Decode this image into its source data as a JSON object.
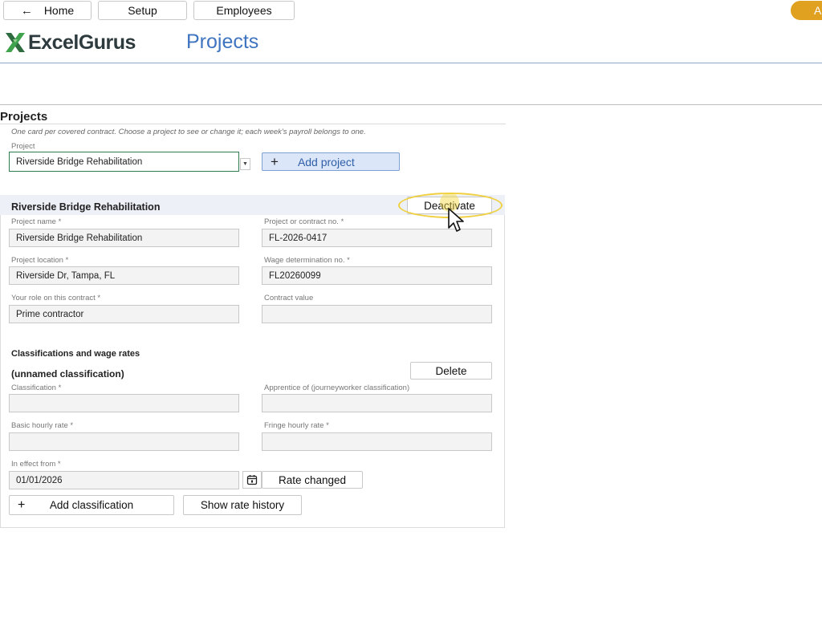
{
  "nav": {
    "home_label": "Home",
    "setup_label": "Setup",
    "employees_label": "Employees",
    "account_initial": "A"
  },
  "header": {
    "logo_text": "ExcelGurus",
    "page_title": "Projects"
  },
  "projects": {
    "section_title": "Projects",
    "description": "One card per covered contract. Choose a project to see or change it; each week's payroll belongs to one.",
    "select_label": "Project",
    "selected_project": "Riverside Bridge Rehabilitation",
    "add_project_label": "Add project"
  },
  "card": {
    "title": "Riverside Bridge Rehabilitation",
    "deactivate_label": "Deactivate",
    "fields": {
      "project_name_label": "Project name *",
      "project_name": "Riverside Bridge Rehabilitation",
      "contract_no_label": "Project or contract no. *",
      "contract_no": "FL-2026-0417",
      "location_label": "Project location *",
      "location": "Riverside Dr, Tampa, FL",
      "wage_det_label": "Wage determination no. *",
      "wage_det": "FL20260099",
      "role_label": "Your role on this contract *",
      "role": "Prime contractor",
      "contract_value_label": "Contract value",
      "contract_value": ""
    }
  },
  "classifications": {
    "heading": "Classifications and wage rates",
    "item_title": "(unnamed classification)",
    "delete_label": "Delete",
    "classification_label": "Classification *",
    "classification": "",
    "apprentice_label": "Apprentice of (journeyworker classification)",
    "apprentice": "",
    "basic_rate_label": "Basic hourly rate *",
    "basic_rate": "",
    "fringe_rate_label": "Fringe hourly rate *",
    "fringe_rate": "",
    "effective_label": "In effect from *",
    "effective_date": "01/01/2026",
    "rate_changed_label": "Rate changed",
    "add_classification_label": "Add classification",
    "show_history_label": "Show rate history"
  },
  "colors": {
    "accent": "#e0a020",
    "title_blue": "#3f74c0",
    "add_button_bg": "#dbe6f8",
    "highlight": "#f0d040"
  }
}
